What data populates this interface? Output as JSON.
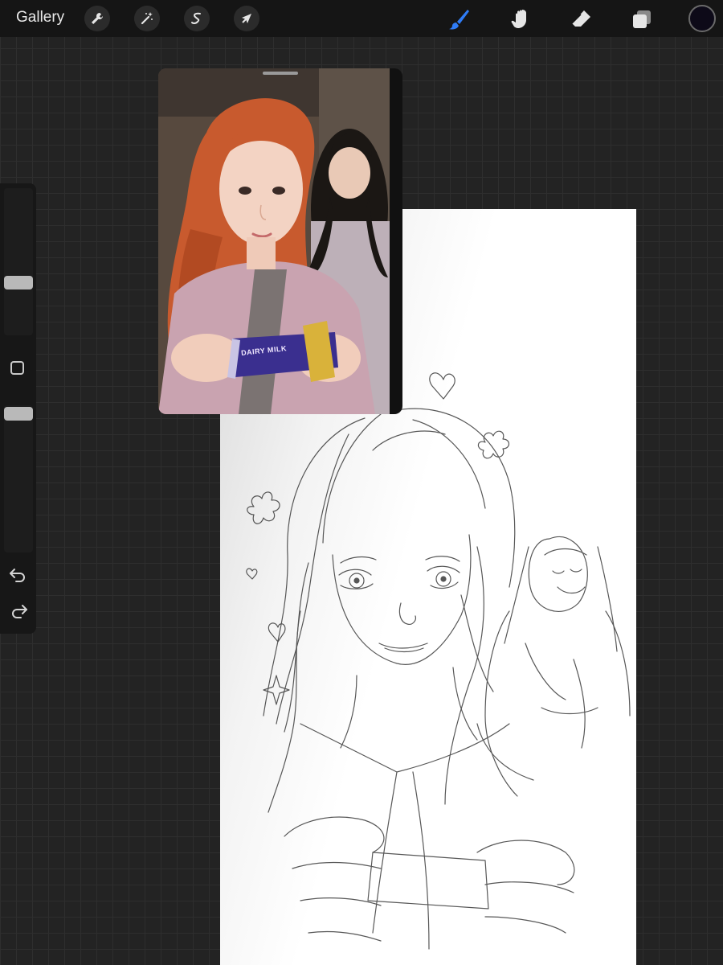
{
  "topbar": {
    "gallery_label": "Gallery",
    "left_tools": [
      "wrench-icon",
      "magic-wand-icon",
      "selection-icon",
      "transform-arrow-icon"
    ],
    "right_tools": [
      "brush-icon",
      "smudge-icon",
      "eraser-icon",
      "layers-icon"
    ],
    "active_tool": "brush-icon",
    "accent_color": "#2f7cf6",
    "current_color": "#0d0a18"
  },
  "sidebar": {
    "brush_size_level": 0.5,
    "opacity_level": 1.0
  },
  "reference": {
    "candy_text": "DAIRY MILK"
  }
}
